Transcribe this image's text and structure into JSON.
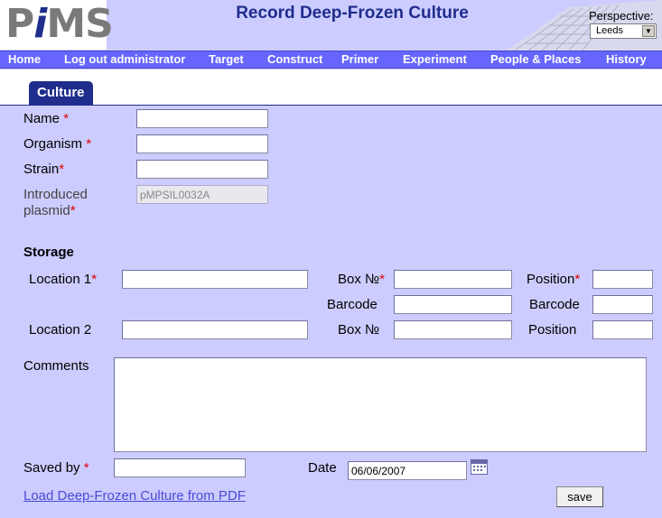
{
  "app": {
    "logo_p": "P",
    "logo_i": "i",
    "logo_ms": "MS"
  },
  "page_title": "Record Deep-Frozen Culture",
  "perspective": {
    "label": "Perspective:",
    "selected": "Leeds",
    "arrow": "▼"
  },
  "nav": [
    "Home",
    "Log out administrator",
    "Target",
    "Construct",
    "Primer",
    "Experiment",
    "People & Places",
    "History"
  ],
  "tab": {
    "label": "Culture"
  },
  "form": {
    "name_label": "Name",
    "organism_label": "Organism",
    "strain_label": "Strain",
    "plasmid_label_1": "Introduced",
    "plasmid_label_2": "plasmid",
    "plasmid_value": "pMPSIL0032A",
    "required_mark": "*"
  },
  "storage": {
    "title": "Storage",
    "location1_label": "Location 1",
    "location2_label": "Location 2",
    "box_label": "Box №",
    "position_label": "Position",
    "barcode_label": "Barcode"
  },
  "comments_label": "Comments",
  "saved_by_label": "Saved by",
  "date_label": "Date",
  "date_value": "06/06/2007",
  "load_pdf_link": "Load Deep-Frozen Culture from PDF",
  "save_button": "save"
}
